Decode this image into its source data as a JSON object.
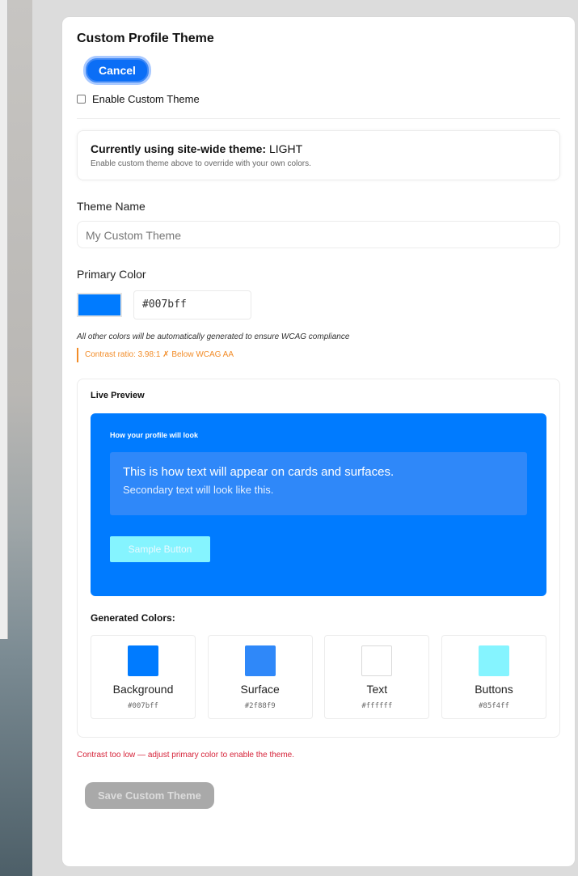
{
  "panel": {
    "title": "Custom Profile Theme",
    "cancel_label": "Cancel",
    "enable_label": "Enable Custom Theme",
    "current_theme": {
      "label": "Currently using site-wide theme:",
      "value": "LIGHT",
      "hint": "Enable custom theme above to override with your own colors."
    },
    "theme_name": {
      "label": "Theme Name",
      "placeholder": "My Custom Theme"
    },
    "primary_color": {
      "label": "Primary Color",
      "swatch_color": "#007bff",
      "hex_value": "#007bff"
    },
    "auto_note": "All other colors will be automatically generated to ensure WCAG compliance",
    "contrast_warning": "Contrast ratio: 3.98:1 ✗ Below WCAG AA",
    "preview": {
      "title": "Live Preview",
      "heading": "How your profile will look",
      "surface_line1": "This is how text will appear on cards and surfaces.",
      "surface_line2": "Secondary text will look like this.",
      "sample_button": "Sample Button",
      "generated_title": "Generated Colors:",
      "colors": [
        {
          "name": "Background",
          "hex": "#007bff",
          "color": "#007bff"
        },
        {
          "name": "Surface",
          "hex": "#2f88f9",
          "color": "#2f88f9"
        },
        {
          "name": "Text",
          "hex": "#ffffff",
          "color": "#ffffff"
        },
        {
          "name": "Buttons",
          "hex": "#85f4ff",
          "color": "#85f4ff"
        }
      ]
    },
    "error_text": "Contrast too low — adjust primary color to enable the theme.",
    "save_label": "Save Custom Theme"
  }
}
